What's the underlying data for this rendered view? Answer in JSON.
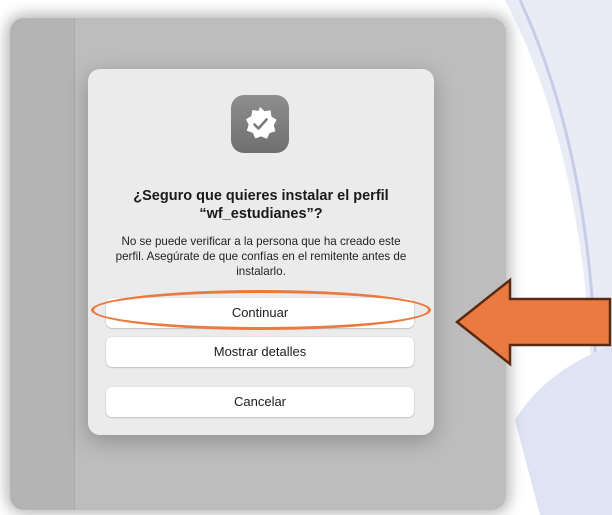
{
  "dialog": {
    "icon": "verified-badge-icon",
    "title": "¿Seguro que quieres instalar el perfil “wf_estudianes”?",
    "message": "No se puede verificar a la persona que ha creado este perfil. Asegúrate de que confías en el remitente antes de instalarlo.",
    "buttons": {
      "continue": "Continuar",
      "details": "Mostrar detalles",
      "cancel": "Cancelar"
    }
  },
  "annotations": {
    "highlight": "ellipse around continue button",
    "arrow": "pointing to continue button",
    "accent_color": "#ea7a3f"
  }
}
